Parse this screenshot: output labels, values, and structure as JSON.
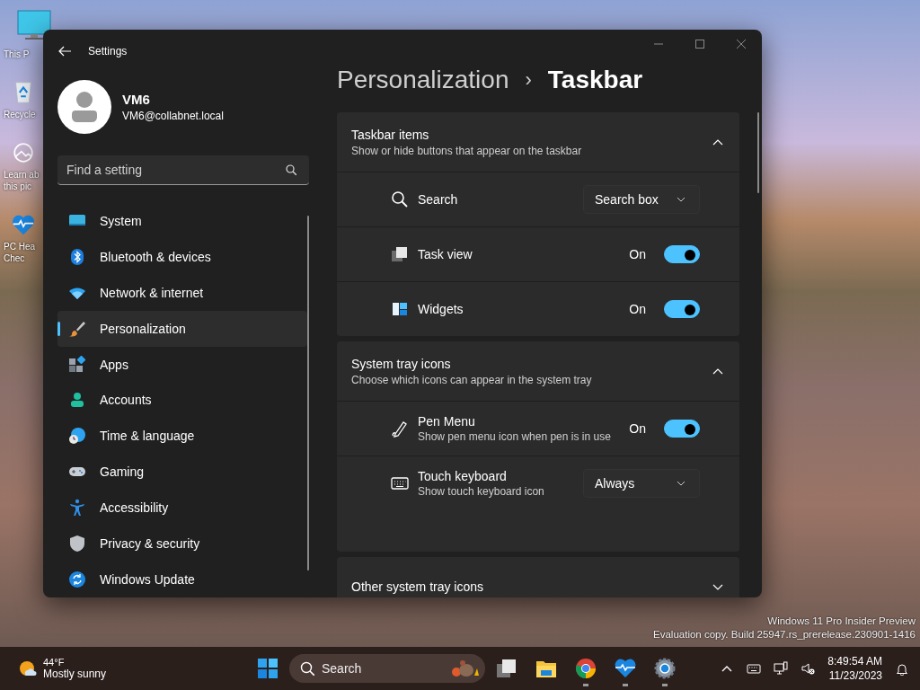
{
  "desktop": {
    "icons": [
      {
        "lines": [
          "This P"
        ]
      },
      {
        "lines": [
          "Recycle"
        ]
      },
      {
        "lines": [
          "Learn ab",
          "this pic"
        ]
      },
      {
        "lines": [
          "PC Hea",
          "Chec"
        ]
      }
    ],
    "system_notice": [
      "Windows 11 Pro Insider Preview",
      "Evaluation copy. Build 25947.rs_prerelease.230901-1416"
    ]
  },
  "window": {
    "title": "Settings"
  },
  "profile": {
    "name": "VM6",
    "email": "VM6@collabnet.local"
  },
  "search": {
    "placeholder": "Find a setting"
  },
  "nav": [
    {
      "label": "System",
      "selected": false
    },
    {
      "label": "Bluetooth & devices",
      "selected": false
    },
    {
      "label": "Network & internet",
      "selected": false
    },
    {
      "label": "Personalization",
      "selected": true
    },
    {
      "label": "Apps",
      "selected": false
    },
    {
      "label": "Accounts",
      "selected": false
    },
    {
      "label": "Time & language",
      "selected": false
    },
    {
      "label": "Gaming",
      "selected": false
    },
    {
      "label": "Accessibility",
      "selected": false
    },
    {
      "label": "Privacy & security",
      "selected": false
    },
    {
      "label": "Windows Update",
      "selected": false
    }
  ],
  "breadcrumb": {
    "parent": "Personalization",
    "separator": "›",
    "current": "Taskbar"
  },
  "sections": [
    {
      "title": "Taskbar items",
      "subtitle": "Show or hide buttons that appear on the taskbar",
      "expanded": true,
      "rows": [
        {
          "kind": "dropdown",
          "label": "Search",
          "value": "Search box"
        },
        {
          "kind": "toggle",
          "label": "Task view",
          "on": true,
          "state_label": "On"
        },
        {
          "kind": "toggle",
          "label": "Widgets",
          "on": true,
          "state_label": "On"
        }
      ]
    },
    {
      "title": "System tray icons",
      "subtitle": "Choose which icons can appear in the system tray",
      "expanded": true,
      "rows": [
        {
          "kind": "toggle",
          "label": "Pen Menu",
          "description": "Show pen menu icon when pen is in use",
          "on": true,
          "state_label": "On"
        },
        {
          "kind": "dropdown",
          "label": "Touch keyboard",
          "description": "Show touch keyboard icon",
          "value": "Always"
        }
      ]
    },
    {
      "title": "Other system tray icons",
      "expanded": false
    }
  ],
  "taskbar": {
    "weather": {
      "temperature": "44°F",
      "condition": "Mostly sunny"
    },
    "search": {
      "placeholder": "Search"
    },
    "apps": [
      {
        "running": false
      },
      {
        "running": false
      },
      {
        "running": false
      },
      {
        "running": true
      },
      {
        "running": true
      },
      {
        "running": true
      }
    ],
    "clock": {
      "time": "8:49:54 AM",
      "date": "11/23/2023"
    }
  }
}
